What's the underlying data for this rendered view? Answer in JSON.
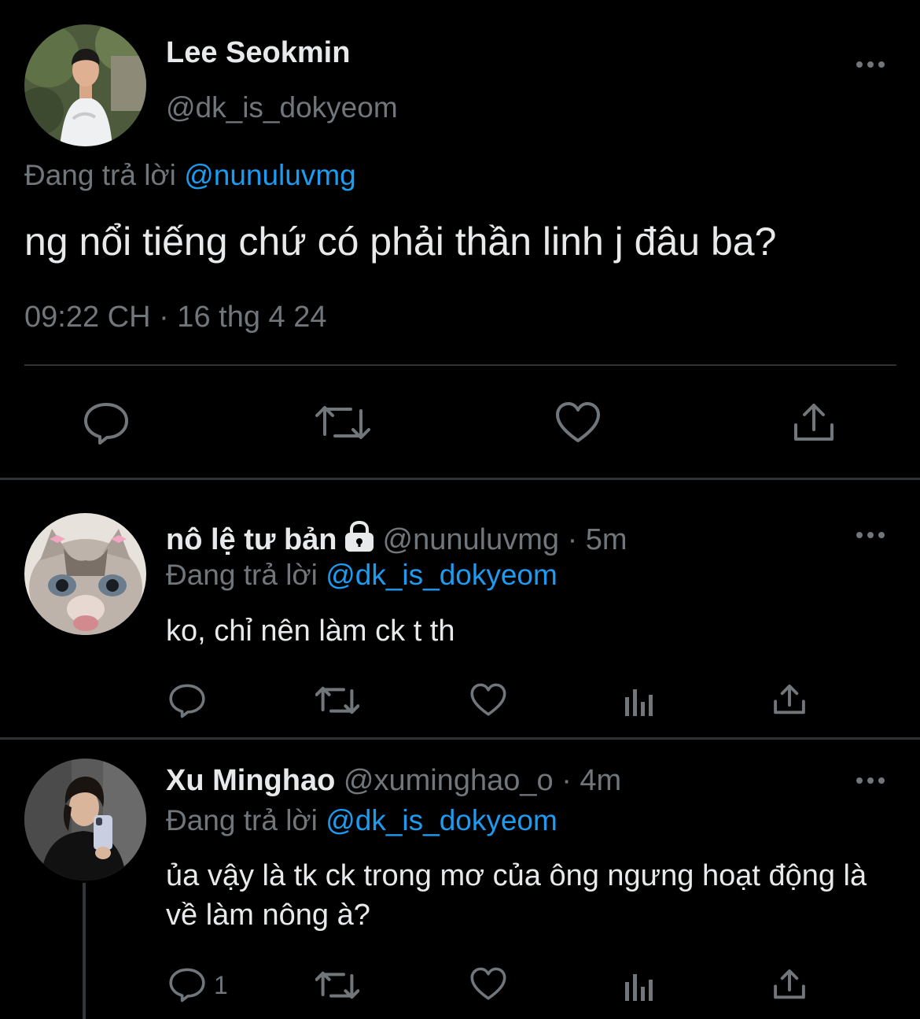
{
  "main_tweet": {
    "name": "Lee Seokmin",
    "handle": "@dk_is_dokyeom",
    "reply_prefix": "Đang trả lời",
    "reply_mention": "@nunuluvmg",
    "text": "ng nổi tiếng chứ có phải thần linh j đâu ba?",
    "timestamp": "09:22 CH · 16 thg 4 24",
    "actions": [
      "reply-icon",
      "retweet-icon",
      "like-icon",
      "share-icon"
    ]
  },
  "replies": [
    {
      "name": "nô lệ tư bản",
      "protected_icon": "lock-icon",
      "handle": "@nunuluvmg",
      "separator": "·",
      "time": "5m",
      "reply_prefix": "Đang trả lời",
      "reply_mention": "@dk_is_dokyeom",
      "text": "ko, chỉ nên làm ck t th",
      "reply_count": ""
    },
    {
      "name": "Xu Minghao",
      "handle": "@xuminghao_o",
      "separator": "·",
      "time": "4m",
      "reply_prefix": "Đang trả lời",
      "reply_mention": "@dk_is_dokyeom",
      "text": "ủa vậy là tk ck trong mơ của ông ngưng hoạt động là về làm nông à?",
      "reply_count": "1"
    }
  ],
  "colors": {
    "background": "#000000",
    "text": "#e7e9ea",
    "muted": "#71767b",
    "link": "#1d9bf0",
    "divider": "#2f3336"
  }
}
